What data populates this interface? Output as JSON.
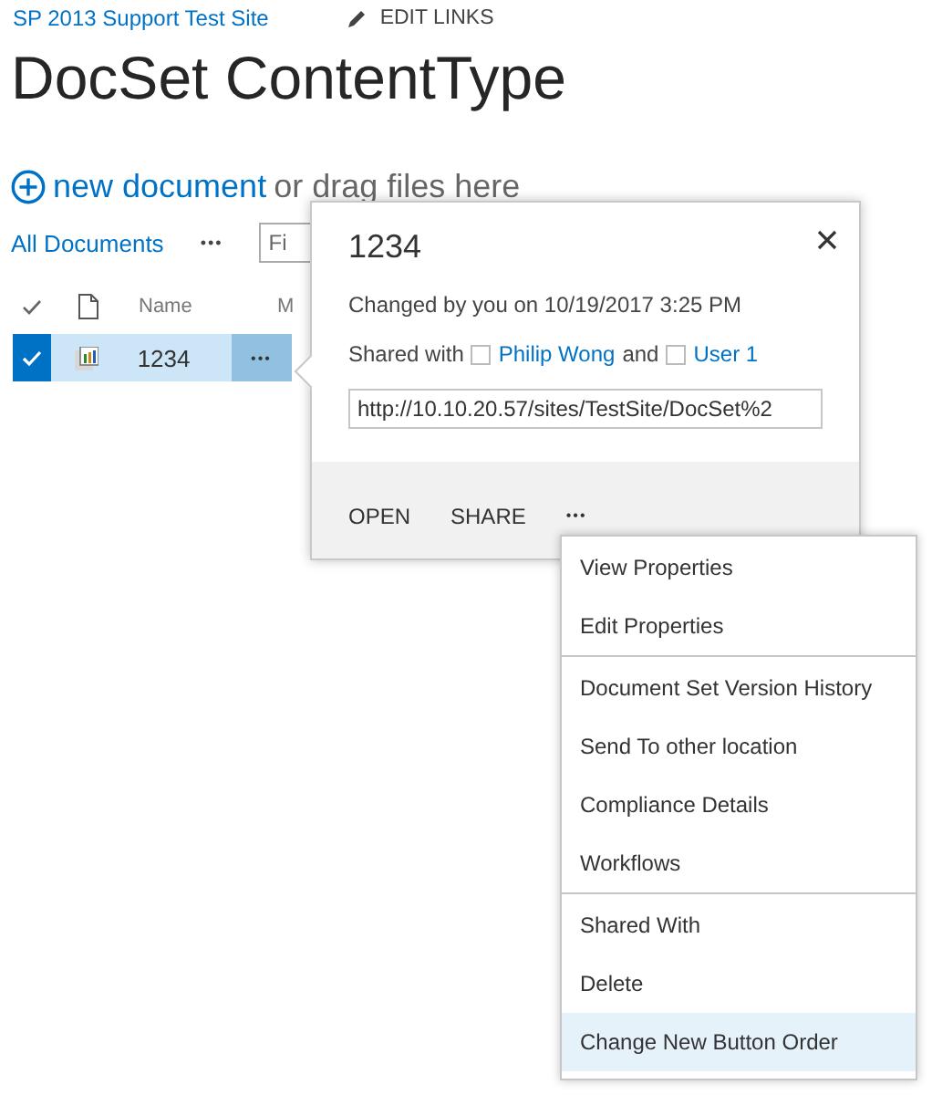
{
  "header": {
    "site_link": "SP 2013 Support Test Site",
    "edit_links": "EDIT LINKS",
    "title": "DocSet ContentType"
  },
  "new_document": {
    "link": "new document",
    "hint": "or drag files here"
  },
  "views": {
    "current": "All Documents",
    "more": "•••",
    "search": {
      "placeholder": "Fi"
    }
  },
  "table": {
    "columns": [
      "Name",
      "M"
    ],
    "rows": [
      {
        "name": "1234",
        "selected": true,
        "menu": "•••"
      }
    ]
  },
  "callout": {
    "title": "1234",
    "changed": "Changed by you on 10/19/2017 3:25 PM",
    "shared_label": "Shared with",
    "shared_users": [
      "Philip Wong",
      "User 1"
    ],
    "joiner": "and",
    "url": "http://10.10.20.57/sites/TestSite/DocSet%2",
    "actions": [
      "OPEN",
      "SHARE"
    ],
    "more": "•••"
  },
  "menu": {
    "groups": [
      [
        {
          "label": "View Properties",
          "selected": false
        },
        {
          "label": "Edit Properties",
          "selected": false
        }
      ],
      [
        {
          "label": "Document Set Version History",
          "selected": false
        },
        {
          "label": "Send To other location",
          "selected": false
        },
        {
          "label": "Compliance Details",
          "selected": false
        },
        {
          "label": "Workflows",
          "selected": false
        }
      ],
      [
        {
          "label": "Shared With",
          "selected": false
        },
        {
          "label": "Delete",
          "selected": false
        },
        {
          "label": "Change New Button Order",
          "selected": true
        }
      ]
    ]
  }
}
